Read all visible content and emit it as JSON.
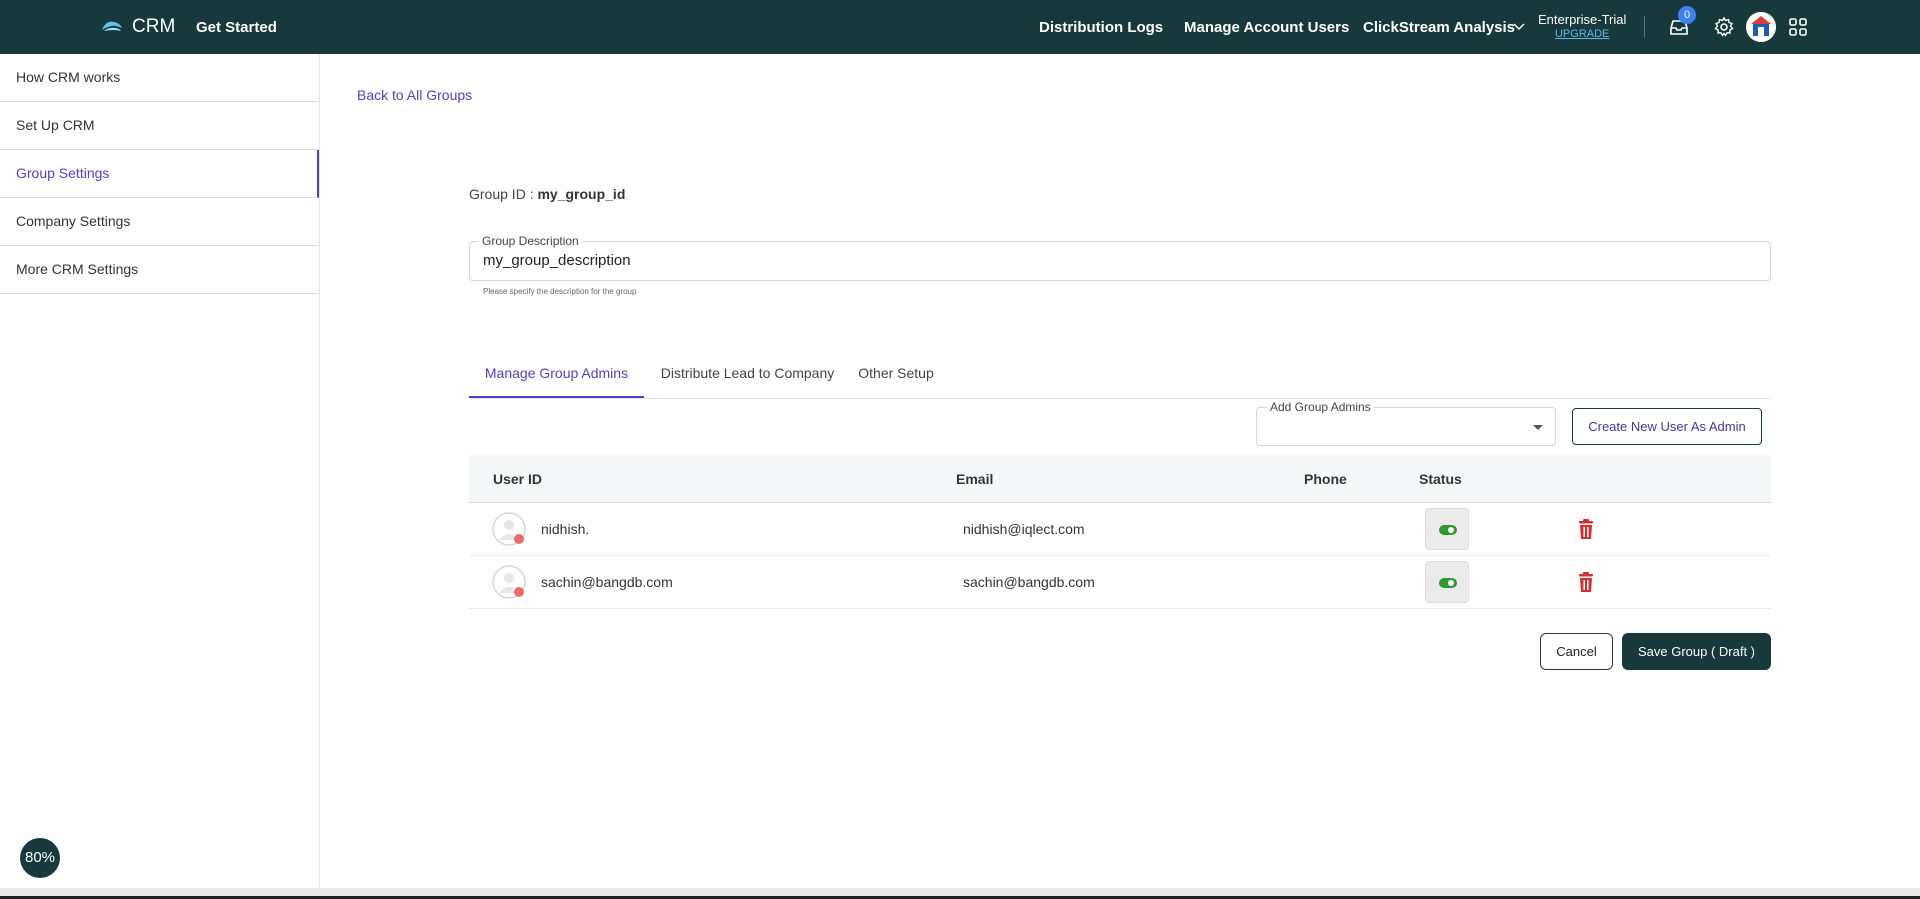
{
  "topbar": {
    "app_name": "CRM",
    "get_started": "Get Started",
    "nav": [
      "Distribution Logs",
      "Manage Account Users",
      "ClickStream Analysis"
    ],
    "plan_name": "Enterprise-Trial",
    "plan_upgrade": "UPGRADE",
    "notification_count": "0",
    "icons": [
      "cloud-logo-icon",
      "chevron-down-icon",
      "inbox-icon",
      "gear-icon",
      "user-avatar-icon",
      "apps-grid-icon"
    ]
  },
  "sidebar": {
    "items": [
      {
        "label": "How CRM works"
      },
      {
        "label": "Set Up CRM"
      },
      {
        "label": "Group Settings"
      },
      {
        "label": "Company Settings"
      },
      {
        "label": "More CRM Settings"
      }
    ],
    "zoom": "80%"
  },
  "main": {
    "back_link": "Back to All Groups",
    "group_id_label": "Group ID : ",
    "group_id_value": "my_group_id",
    "description": {
      "label": "Group Description",
      "value": "my_group_description",
      "help": "Please specify the description for the group"
    },
    "tabs": [
      {
        "label": "Manage Group Admins"
      },
      {
        "label": "Distribute Lead to Company"
      },
      {
        "label": "Other Setup"
      }
    ],
    "add_admins_label": "Add Group Admins",
    "create_user_button": "Create New User As Admin",
    "table": {
      "headers": [
        "User ID",
        "Email",
        "Phone",
        "Status"
      ],
      "rows": [
        {
          "user_id": "nidhish.",
          "email": "nidhish@iqlect.com",
          "phone": "",
          "status": "active"
        },
        {
          "user_id": "sachin@bangdb.com",
          "email": "sachin@bangdb.com",
          "phone": "",
          "status": "active"
        }
      ]
    },
    "cancel_button": "Cancel",
    "save_button": "Save Group ( Draft )"
  },
  "colors": {
    "topbar": "#17393b",
    "accent": "#4b43c9",
    "delete": "#d32f2f",
    "toggle_on": "#2e9b2e"
  }
}
